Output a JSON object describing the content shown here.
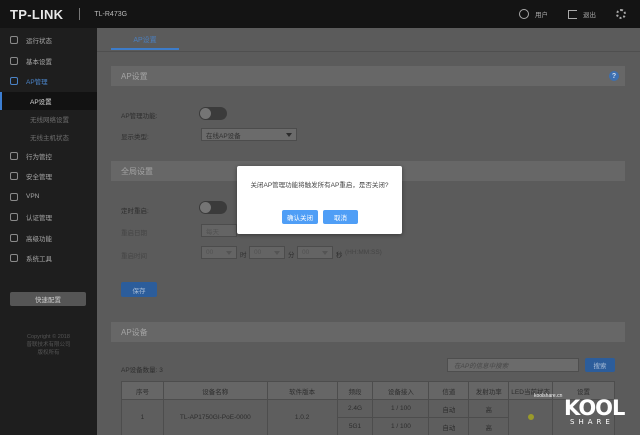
{
  "header": {
    "brand": "TP-LINK",
    "model": "TL-R473G",
    "user_label": "用户",
    "logout_label": "退出"
  },
  "sidebar": {
    "items": [
      {
        "label": "运行状态",
        "icon": "monitor-icon"
      },
      {
        "label": "基本设置",
        "icon": "gear-icon"
      },
      {
        "label": "AP管理",
        "icon": "ap-icon",
        "active": true
      },
      {
        "label": "行为管控",
        "icon": "control-icon"
      },
      {
        "label": "安全管理",
        "icon": "shield-icon"
      },
      {
        "label": "VPN",
        "icon": "vpn-icon"
      },
      {
        "label": "认证管理",
        "icon": "auth-icon"
      },
      {
        "label": "高级功能",
        "icon": "advanced-icon"
      },
      {
        "label": "系统工具",
        "icon": "tools-icon"
      }
    ],
    "subitems": [
      {
        "label": "AP设置",
        "current": true
      },
      {
        "label": "无线网络设置"
      },
      {
        "label": "无线主机状态"
      }
    ],
    "quick_config": "快速配置",
    "copyright_line1": "Copyright © 2018",
    "copyright_line2": "普联技术有限公司",
    "copyright_line3": "版权所有"
  },
  "main": {
    "tab": "AP设置",
    "ap_section": {
      "title": "AP设置",
      "ap_mgmt_label": "AP管理功能:",
      "display_type_label": "显示类型:",
      "display_type_value": "在线AP设备"
    },
    "global_section": {
      "title": "全局设置",
      "timed_reboot_label": "定时重启:",
      "reboot_cycle_label": "重启日期",
      "reboot_cycle_value": "每天",
      "reboot_time_label": "重启时间",
      "time_h": "00",
      "time_m": "00",
      "time_s": "00",
      "unit_h": "时",
      "unit_m": "分",
      "unit_s": "秒",
      "time_format": "(HH:MM:SS)",
      "save_button": "保存"
    },
    "device_section": {
      "title": "AP设备",
      "count_label": "AP设备数量: 3",
      "search_placeholder": "在AP的信息中搜索",
      "search_button": "搜索",
      "columns": [
        "序号",
        "设备名称",
        "软件版本",
        "频段",
        "设备接入",
        "信道",
        "发射功率",
        "LED当前状态",
        "设置"
      ],
      "rows": [
        {
          "index": "1",
          "name": "TL-AP1750GI-PoE-0000",
          "version": "1.0.2",
          "band1": "2.4G",
          "access1": "1 / 100",
          "channel1": "自动",
          "power1": "高",
          "band2": "5G1",
          "access2": "1 / 100",
          "channel2": "自动",
          "power2": "高"
        }
      ]
    }
  },
  "modal": {
    "message": "关闭AP管理功能将触发所有AP重启，是否关闭?",
    "confirm": "确认关闭",
    "cancel": "取消"
  },
  "watermark": {
    "small": "koolshare.cn",
    "big": "KOOL",
    "sub": "SHARE"
  }
}
